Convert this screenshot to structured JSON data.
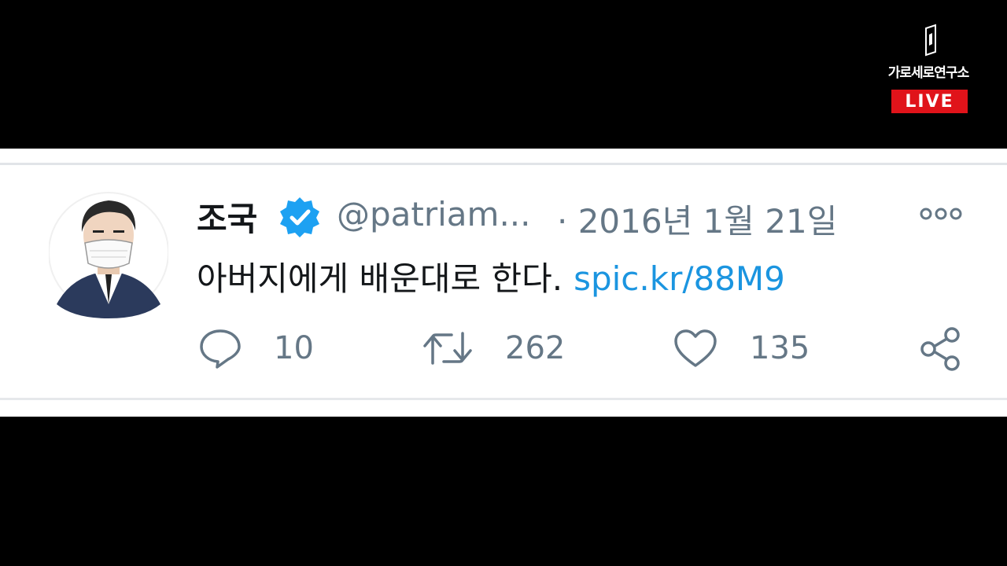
{
  "overlay": {
    "channel_name": "가로세로연구소",
    "live_label": "LIVE",
    "logo_icon": "channel-logo-icon",
    "live_color": "#e0131a"
  },
  "tweet": {
    "author_name": "조국",
    "verified_icon": "verified-badge-icon",
    "handle": "@patriam...",
    "date": "· 2016년 1월 21일",
    "text": "아버지에게 배운대로 한다.",
    "link": "spic.kr/88M9",
    "more_icon": "more-options-icon",
    "reply_count": "10",
    "retweet_count": "262",
    "like_count": "135",
    "colors": {
      "text": "#14171a",
      "secondary": "#657786",
      "link": "#1b95e0",
      "verified": "#1da1f2"
    }
  }
}
